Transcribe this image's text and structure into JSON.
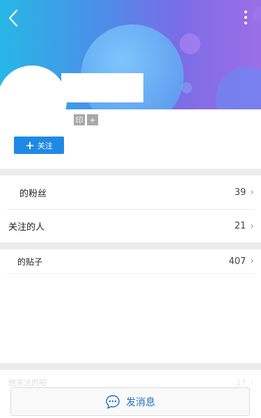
{
  "header": {
    "tags": [
      "印",
      "+"
    ]
  },
  "follow_button": {
    "plus": "+",
    "label": "关注"
  },
  "rows": [
    {
      "label": "的粉丝",
      "count": "39"
    },
    {
      "label": "关注的人",
      "count": "21"
    },
    {
      "label": "的贴子",
      "count": "407"
    }
  ],
  "faded_row": {
    "label": "他关注的吧",
    "count": "17"
  },
  "message_button": {
    "label": "发消息"
  },
  "colors": {
    "accent": "#1f8ae6",
    "header_start": "#27b7e6",
    "header_end": "#9b6fe6",
    "separator": "#ececec",
    "message_text": "#1a6fc6"
  }
}
